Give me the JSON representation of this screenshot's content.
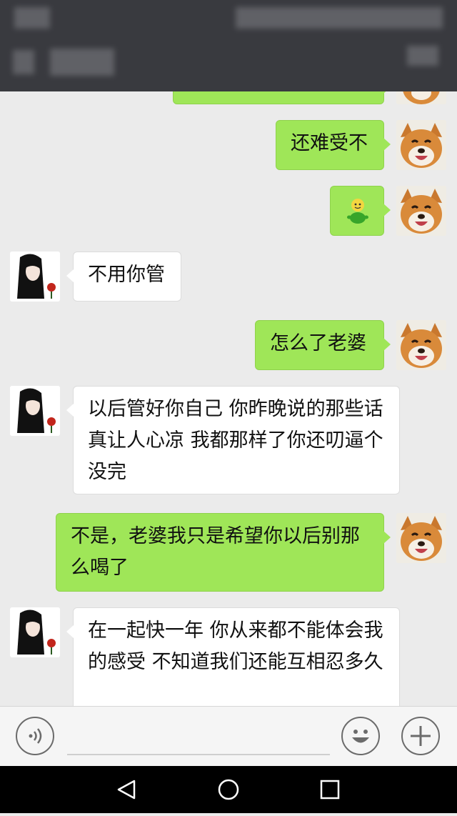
{
  "messages": [
    {
      "side": "right",
      "text": "还难受不",
      "avatar": "dog"
    },
    {
      "side": "right",
      "sticker": "green-figure-emoji",
      "avatar": "dog"
    },
    {
      "side": "left",
      "text": "不用你管",
      "avatar": "girl"
    },
    {
      "side": "right",
      "text": "怎么了老婆",
      "avatar": "dog"
    },
    {
      "side": "left",
      "text": "以后管好你自己 你昨晚说的那些话真让人心凉  我都那样了你还叨逼个没完",
      "avatar": "girl"
    },
    {
      "side": "right",
      "text": "不是，老婆我只是希望你以后别那么喝了",
      "avatar": "dog"
    },
    {
      "side": "left",
      "text": "在一起快一年  你从来都不能体会我的感受  不知道我们还能互相忍多久",
      "avatar": "girl"
    }
  ],
  "input": {
    "voice_icon": "voice-icon",
    "emoji_icon": "emoji-icon",
    "plus_icon": "plus-icon"
  },
  "navbar": {
    "back_icon": "back-icon",
    "home_icon": "home-icon",
    "recents_icon": "recents-icon"
  },
  "colors": {
    "right_bubble": "#9fe658",
    "left_bubble": "#ffffff",
    "chat_bg": "#ebebeb",
    "header_bg": "#393a3f"
  }
}
